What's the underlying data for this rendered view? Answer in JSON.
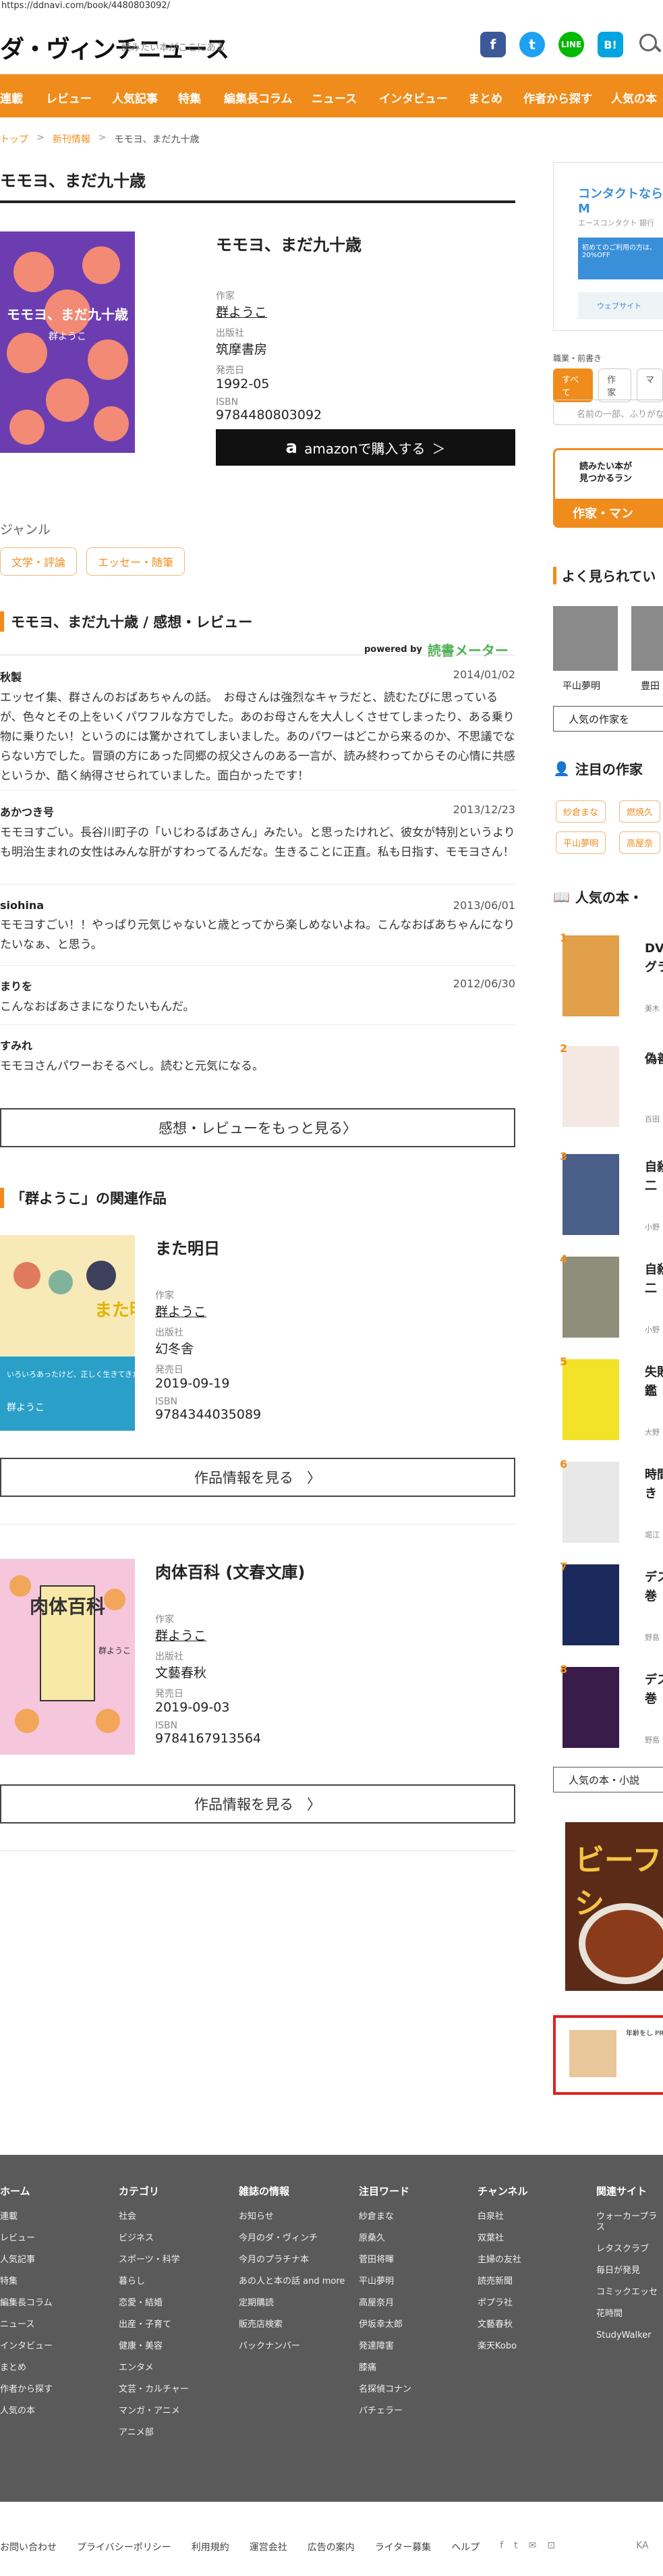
{
  "url": "https://ddnavi.com/book/4480803092/",
  "site": {
    "logo": "ダ・ヴィンチニュース",
    "tagline": "読みたい本がここにある"
  },
  "social": {
    "fb": "f",
    "tw": "t",
    "line": "LINE",
    "hatena": "B!"
  },
  "nav": [
    "連載",
    "レビュー",
    "人気記事",
    "特集",
    "編集長コラム",
    "ニュース",
    "インタビュー",
    "まとめ",
    "作者から探す",
    "人気の本"
  ],
  "breadcrumb": {
    "home": "トップ",
    "sep": ">",
    "section": "新刊情報",
    "current": "モモヨ、まだ九十歳"
  },
  "page_title": "モモヨ、まだ九十歳",
  "book": {
    "title": "モモヨ、まだ九十歳",
    "cover_title": "モモヨ、まだ九十歳",
    "cover_author": "群ようこ",
    "author_label": "作家",
    "author": "群ようこ",
    "publisher_label": "出版社",
    "publisher": "筑摩書房",
    "date_label": "発売日",
    "date": "1992-05",
    "isbn_label": "ISBN",
    "isbn": "9784480803092",
    "amazon_label": "amazonで購入する",
    "amazon_mark": "a",
    "amazon_arrow": "＞"
  },
  "genre": {
    "label": "ジャンル",
    "tags": [
      "文学・評論",
      "エッセー・随筆"
    ]
  },
  "reviews_section": {
    "title": "モモヨ、まだ九十歳 / 感想・レビュー",
    "powered_label": "powered by",
    "powered_brand": "読書メーター",
    "more_label": "感想・レビューをもっと見る",
    "more_arrow": "〉"
  },
  "reviews": [
    {
      "user": "秋製",
      "date": "2014/01/02",
      "text": "エッセイ集、群さんのおばあちゃんの話。　お母さんは強烈なキャラだと、読むたびに思っているが、色々とその上をいくパワフルな方でした。あのお母さんを大人しくさせてしまったり、ある乗り物に乗りたい！というのには驚かされてしまいました。あのパワーはどこから来るのか、不思議でならない方でした。冒頭の方にあった同郷の叔父さんのある一言が、読み終わってからその心情に共感というか、酷く納得させられていました。面白かったです！"
    },
    {
      "user": "あかつき号",
      "date": "2013/12/23",
      "text": "モモヨすごい。長谷川町子の「いじわるばあさん」みたい。と思ったけれど、彼女が特別というよりも明治生まれの女性はみんな肝がすわってるんだな。生きることに正直。私も日指す、モモヨさん！"
    },
    {
      "user": "siohina",
      "date": "2013/06/01",
      "text": "モモヨすごい！！やっぱり元気じゃないと歳とってから楽しめないよね。こんなおばあちゃんになりたいなぁ、と思う。"
    },
    {
      "user": "まりを",
      "date": "2012/06/30",
      "text": "こんなおばあさまになりたいもんだ。"
    },
    {
      "user": "すみれ",
      "date": "",
      "text": "モモヨさんパワーおそるべし。読むと元気になる。"
    }
  ],
  "related": {
    "title": "「群ようこ」の関連作品",
    "books": [
      {
        "title": "また明日",
        "cover_title": "また明日",
        "cover_author": "群ようこ",
        "cover_text": "いろいろあったけど、正しく生きてきたよね。",
        "author_label": "作家",
        "author": "群ようこ",
        "publisher_label": "出版社",
        "publisher": "幻冬舎",
        "date_label": "発売日",
        "date": "2019-09-19",
        "isbn_label": "ISBN",
        "isbn": "9784344035089",
        "button": "作品情報を見る",
        "button_arrow": "〉"
      },
      {
        "title": "肉体百科 (文春文庫)",
        "cover_title": "肉体百科",
        "cover_author": "群ようこ",
        "author_label": "作家",
        "author": "群ようこ",
        "publisher_label": "出版社",
        "publisher": "文藝春秋",
        "date_label": "発売日",
        "date": "2019-09-03",
        "isbn_label": "ISBN",
        "isbn": "9784167913564",
        "button": "作品情報を見る",
        "button_arrow": "〉"
      }
    ]
  },
  "sidebar": {
    "ad1": {
      "title": "コンタクトならM",
      "sub": "エースコンタクト 銀行",
      "blue_text": "初めてのご利用の方は、20%OFF",
      "map_text": "ウェブサイト"
    },
    "search_label": "職業・前書き",
    "tabs": [
      "すべて",
      "作家",
      "マ"
    ],
    "search_placeholder": "名前の一部、ふりがな",
    "banner": {
      "line1": "読みたい本が",
      "line2": "見つかるラン",
      "bottom": "作家・マン"
    },
    "popular_authors_title": "よく見られてい",
    "authors": [
      "平山夢明",
      "豊田"
    ],
    "authors_button": "人気の作家を",
    "attention_title": "注目の作家",
    "chips": [
      "紗倉まな",
      "燃焼久",
      "平山夢明",
      "高屋奈"
    ],
    "books_title": "人気の本・",
    "ranking": [
      {
        "num": "1",
        "title": "DVDグラ",
        "author": "美木"
      },
      {
        "num": "2",
        "title": "偽善",
        "author": "百田"
      },
      {
        "num": "3",
        "title": "自殺十二",
        "author": "小野"
      },
      {
        "num": "4",
        "title": "自殺十二",
        "author": "小野"
      },
      {
        "num": "5",
        "title": "失敗図鑑",
        "author": "大野"
      },
      {
        "num": "6",
        "title": "時間生き",
        "author": "堀江"
      },
      {
        "num": "7",
        "title": "デス上巻",
        "author": "野島"
      },
      {
        "num": "8",
        "title": "デス下巻",
        "author": "野島"
      }
    ],
    "books_button": "人気の本・小説",
    "food_ad": "ビーフシ",
    "red_ad": "年齢をし PR"
  },
  "footer": {
    "cols": [
      {
        "head": "ホーム",
        "items": [
          "連載",
          "レビュー",
          "人気記事",
          "特集",
          "編集長コラム",
          "ニュース",
          "インタビュー",
          "まとめ",
          "作者から探す",
          "人気の本"
        ]
      },
      {
        "head": "カテゴリ",
        "items": [
          "社会",
          "ビジネス",
          "スポーツ・科学",
          "暮らし",
          "恋愛・結婚",
          "出産・子育て",
          "健康・美容",
          "エンタメ",
          "文芸・カルチャー",
          "マンガ・アニメ",
          "アニメ部"
        ]
      },
      {
        "head": "雑誌の情報",
        "items": [
          "お知らせ",
          "今月のダ・ヴィンチ",
          "今月のプラチナ本",
          "あの人と本の話 and more",
          "定期購読",
          "販売店検索",
          "バックナンバー"
        ]
      },
      {
        "head": "注目ワード",
        "items": [
          "紗倉まな",
          "原桑久",
          "菅田将暉",
          "平山夢明",
          "高屋奈月",
          "伊坂幸太郎",
          "発達障害",
          "膝痛",
          "名探偵コナン",
          "パチェラー"
        ]
      },
      {
        "head": "チャンネル",
        "items": [
          "白泉社",
          "双葉社",
          "主婦の友社",
          "読売新聞",
          "ポプラ社",
          "文藝春秋",
          "楽天Kobo"
        ]
      },
      {
        "head": "関連サイト",
        "items": [
          "ウォーカープラス",
          "レタスクラブ",
          "毎日が発見",
          "コミックエッセ",
          "花時間",
          "StudyWalker"
        ]
      }
    ]
  },
  "bottom_links": [
    "お問い合わせ",
    "プライバシーポリシー",
    "利用規約",
    "運営会社",
    "広告の案内",
    "ライター募集",
    "ヘルプ"
  ],
  "bottom_icons": [
    "f",
    "t",
    "✉",
    "⊡"
  ],
  "bottom_ad_mark": "KA"
}
